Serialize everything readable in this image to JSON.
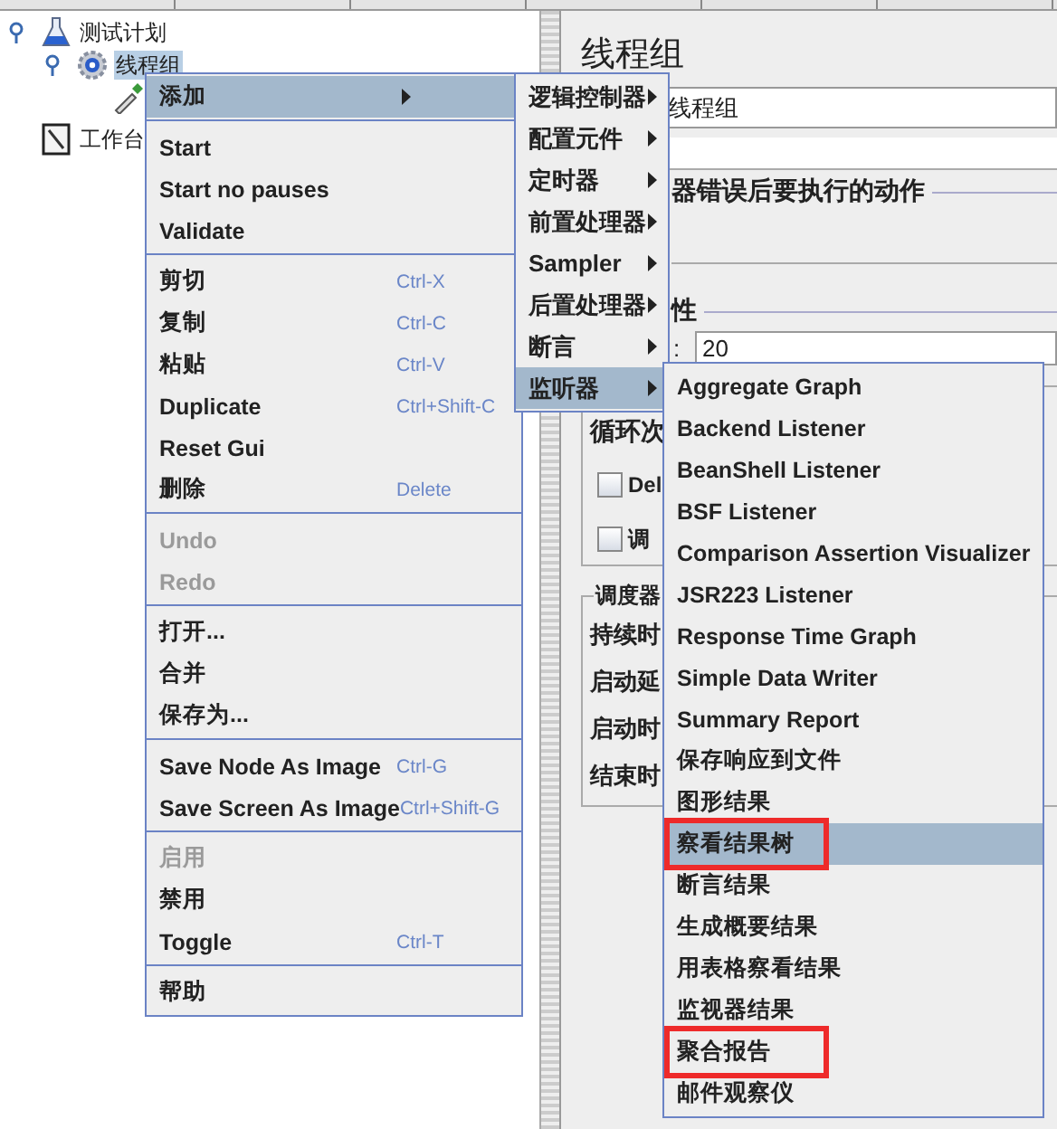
{
  "tree": [
    {
      "label": "测试计划",
      "kind": "plan",
      "selected": false,
      "expanded": true,
      "children": [
        {
          "label": "线程组",
          "kind": "thread-group",
          "selected": true,
          "expanded": true,
          "children": [
            {
              "kind": "sampler"
            }
          ]
        }
      ]
    },
    {
      "label": "工作台",
      "kind": "workbench",
      "selected": false
    }
  ],
  "panel": {
    "title": "线程组",
    "name_field": {
      "value": "线程组"
    },
    "error_section": {
      "title": "器错误后要执行的动作"
    },
    "properties_section": {
      "title": "性",
      "threads_label": ":",
      "threads_field": {
        "value": "20"
      }
    },
    "loop_box": {
      "label": "循环次",
      "checkboxes": [
        {
          "label": "Del",
          "checked": false
        },
        {
          "label": "调",
          "checked": false
        }
      ]
    },
    "scheduler": {
      "title": "调度器",
      "rows": [
        "持续时",
        "启动延",
        "启动时",
        "结束时"
      ]
    }
  },
  "context_menu": [
    {
      "kind": "item",
      "label": "添加",
      "has_submenu": true,
      "selected": true,
      "disabled": false
    },
    {
      "kind": "separator"
    },
    {
      "kind": "item",
      "label": "Start",
      "selected": false,
      "disabled": false
    },
    {
      "kind": "item",
      "label": "Start no pauses",
      "selected": false,
      "disabled": false
    },
    {
      "kind": "item",
      "label": "Validate",
      "selected": false,
      "disabled": false
    },
    {
      "kind": "separator"
    },
    {
      "kind": "item",
      "label": "剪切",
      "shortcut": "Ctrl-X",
      "selected": false,
      "disabled": false
    },
    {
      "kind": "item",
      "label": "复制",
      "shortcut": "Ctrl-C",
      "selected": false,
      "disabled": false
    },
    {
      "kind": "item",
      "label": "粘贴",
      "shortcut": "Ctrl-V",
      "selected": false,
      "disabled": false
    },
    {
      "kind": "item",
      "label": "Duplicate",
      "shortcut": "Ctrl+Shift-C",
      "selected": false,
      "disabled": false
    },
    {
      "kind": "item",
      "label": "Reset Gui",
      "selected": false,
      "disabled": false
    },
    {
      "kind": "item",
      "label": "删除",
      "shortcut": "Delete",
      "selected": false,
      "disabled": false
    },
    {
      "kind": "separator"
    },
    {
      "kind": "item",
      "label": "Undo",
      "selected": false,
      "disabled": true
    },
    {
      "kind": "item",
      "label": "Redo",
      "selected": false,
      "disabled": true
    },
    {
      "kind": "separator"
    },
    {
      "kind": "item",
      "label": "打开...",
      "selected": false,
      "disabled": false
    },
    {
      "kind": "item",
      "label": "合并",
      "selected": false,
      "disabled": false
    },
    {
      "kind": "item",
      "label": "保存为...",
      "selected": false,
      "disabled": false
    },
    {
      "kind": "separator"
    },
    {
      "kind": "item",
      "label": "Save Node As Image",
      "shortcut": "Ctrl-G",
      "selected": false,
      "disabled": false
    },
    {
      "kind": "item",
      "label": "Save Screen As Image",
      "shortcut": "Ctrl+Shift-G",
      "selected": false,
      "disabled": false
    },
    {
      "kind": "separator"
    },
    {
      "kind": "item",
      "label": "启用",
      "selected": false,
      "disabled": true
    },
    {
      "kind": "item",
      "label": "禁用",
      "selected": false,
      "disabled": false
    },
    {
      "kind": "item",
      "label": "Toggle",
      "shortcut": "Ctrl-T",
      "selected": false,
      "disabled": false
    },
    {
      "kind": "separator"
    },
    {
      "kind": "item",
      "label": "帮助",
      "selected": false,
      "disabled": false
    }
  ],
  "add_submenu": [
    {
      "label": "逻辑控制器",
      "has_submenu": true,
      "selected": false
    },
    {
      "label": "配置元件",
      "has_submenu": true,
      "selected": false
    },
    {
      "label": "定时器",
      "has_submenu": true,
      "selected": false
    },
    {
      "label": "前置处理器",
      "has_submenu": true,
      "selected": false
    },
    {
      "label": "Sampler",
      "has_submenu": true,
      "selected": false
    },
    {
      "label": "后置处理器",
      "has_submenu": true,
      "selected": false
    },
    {
      "label": "断言",
      "has_submenu": true,
      "selected": false
    },
    {
      "label": "监听器",
      "has_submenu": true,
      "selected": true
    }
  ],
  "listener_submenu": [
    {
      "label": "Aggregate Graph",
      "selected": false,
      "annotated": false
    },
    {
      "label": "Backend Listener",
      "selected": false,
      "annotated": false
    },
    {
      "label": "BeanShell Listener",
      "selected": false,
      "annotated": false
    },
    {
      "label": "BSF Listener",
      "selected": false,
      "annotated": false
    },
    {
      "label": "Comparison Assertion Visualizer",
      "selected": false,
      "annotated": false
    },
    {
      "label": "JSR223 Listener",
      "selected": false,
      "annotated": false
    },
    {
      "label": "Response Time Graph",
      "selected": false,
      "annotated": false
    },
    {
      "label": "Simple Data Writer",
      "selected": false,
      "annotated": false
    },
    {
      "label": "Summary Report",
      "selected": false,
      "annotated": false
    },
    {
      "label": "保存响应到文件",
      "selected": false,
      "annotated": false
    },
    {
      "label": "图形结果",
      "selected": false,
      "annotated": false
    },
    {
      "label": "察看结果树",
      "selected": true,
      "annotated": true
    },
    {
      "label": "断言结果",
      "selected": false,
      "annotated": false
    },
    {
      "label": "生成概要结果",
      "selected": false,
      "annotated": false
    },
    {
      "label": "用表格察看结果",
      "selected": false,
      "annotated": false
    },
    {
      "label": "监视器结果",
      "selected": false,
      "annotated": false
    },
    {
      "label": "聚合报告",
      "selected": false,
      "annotated": true
    },
    {
      "label": "邮件观察仪",
      "selected": false,
      "annotated": false
    }
  ]
}
